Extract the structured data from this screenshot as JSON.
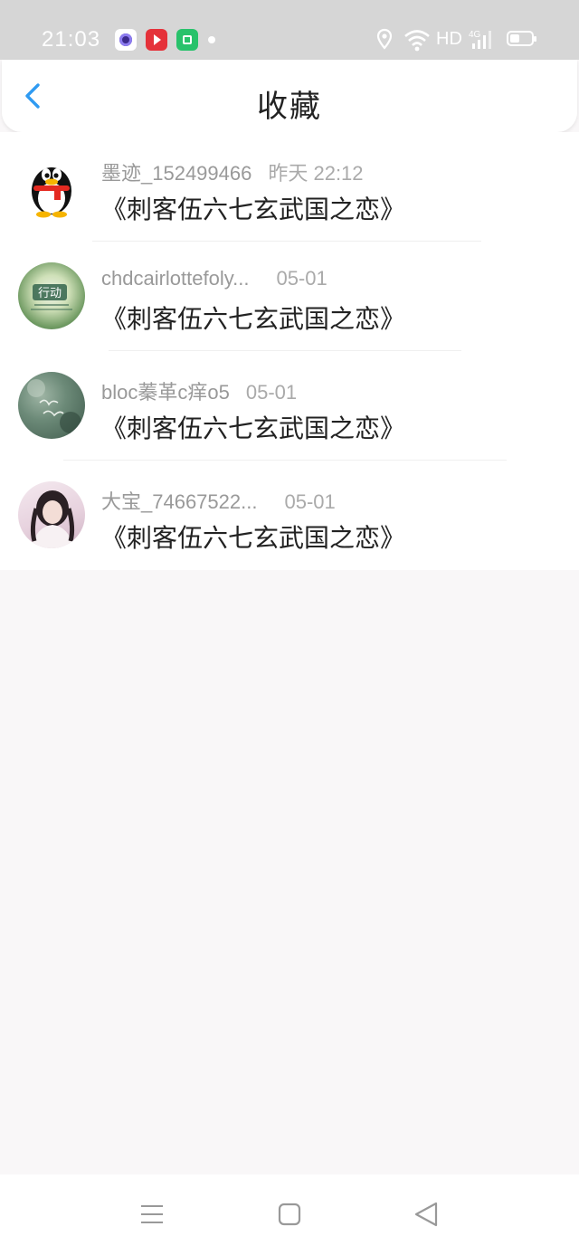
{
  "status_bar": {
    "time": "21:03",
    "network_label": "HD",
    "icons": [
      "app-icon-1",
      "app-icon-2",
      "app-icon-3",
      "location-icon",
      "wifi-icon",
      "4g-signal-icon",
      "battery-icon"
    ]
  },
  "header": {
    "title": "收藏",
    "back_icon": "chevron-left-icon"
  },
  "favorites": [
    {
      "user": "墨迹_152499466",
      "time": "昨天 22:12",
      "title": "《刺客伍六七玄武国之恋》",
      "avatar": "qq-penguin"
    },
    {
      "user": "chdcairlottefoly...",
      "time": "05-01",
      "title": "《刺客伍六七玄武国之恋》",
      "avatar": "行动"
    },
    {
      "user": "bloc蓁革c痒o5",
      "time": "05-01",
      "title": "《刺客伍六七玄武国之恋》",
      "avatar": "hello-august"
    },
    {
      "user": "大宝_74667522...",
      "time": "05-01",
      "title": "《刺客伍六七玄武国之恋》",
      "avatar": "girl-photo"
    }
  ],
  "nav_bar": {
    "icons": [
      "menu-icon",
      "home-icon",
      "back-triangle-icon"
    ]
  },
  "colors": {
    "accent": "#2f9bf2",
    "status_bar": "#d6d6d6",
    "background": "#f9f7f8"
  }
}
